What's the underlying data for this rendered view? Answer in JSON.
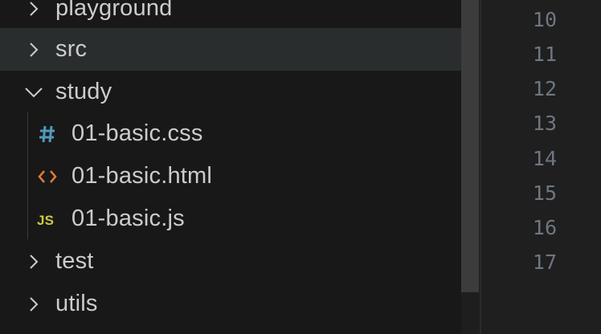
{
  "explorer": {
    "folders_top": [
      {
        "label": "playground",
        "expanded": false
      },
      {
        "label": "src",
        "expanded": false,
        "selected": true
      },
      {
        "label": "study",
        "expanded": true
      }
    ],
    "study_files": [
      {
        "label": "01-basic.css",
        "icon": "css-hash-icon",
        "glyph": "#",
        "color": "#519aba"
      },
      {
        "label": "01-basic.html",
        "icon": "html-brackets-icon",
        "glyph": "<>",
        "color": "#e37933"
      },
      {
        "label": "01-basic.js",
        "icon": "js-icon",
        "glyph": "JS",
        "color": "#cbcb41"
      }
    ],
    "folders_bottom": [
      {
        "label": "test",
        "expanded": false
      },
      {
        "label": "utils",
        "expanded": false
      }
    ]
  },
  "gutter": {
    "line_numbers": [
      "10",
      "11",
      "12",
      "13",
      "14",
      "15",
      "16",
      "17"
    ]
  },
  "colors": {
    "background": "#181818",
    "selected_row": "#2a2d2e",
    "text": "#cccccc",
    "line_number": "#6e7681"
  }
}
